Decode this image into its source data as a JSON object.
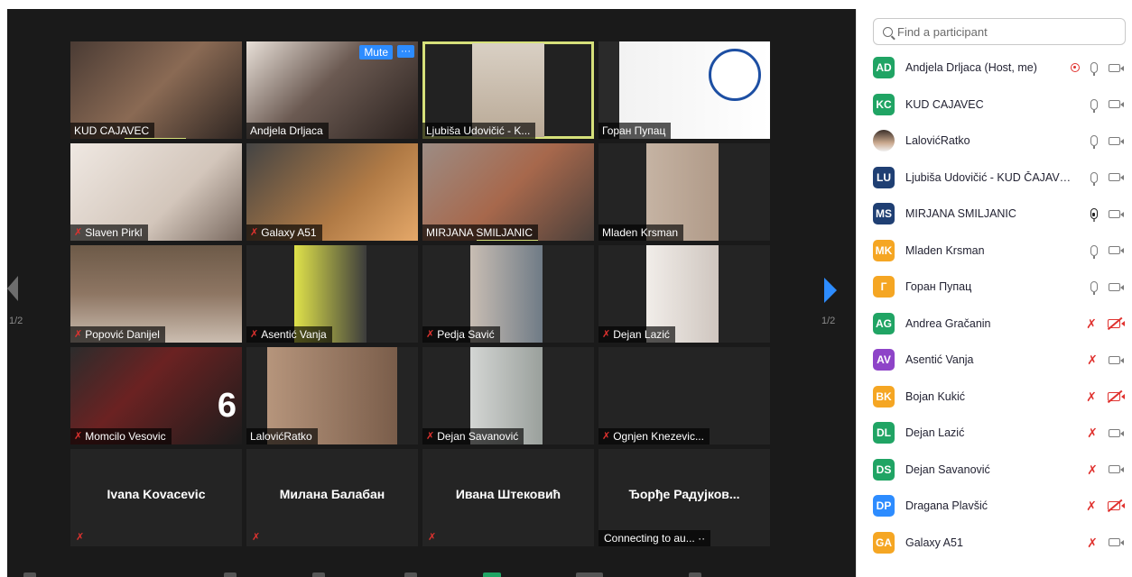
{
  "gallery": {
    "tiles": [
      {
        "name": "KUD CAJAVEC",
        "muted": false
      },
      {
        "name": "Andjela Drljaca",
        "muted": false,
        "hover_mute": "Mute",
        "hover_more": "···"
      },
      {
        "name": "Ljubiša Udovičić - K...",
        "muted": false
      },
      {
        "name": "Горан Пупац",
        "muted": false
      },
      {
        "name": "Slaven Pirkl",
        "muted": true
      },
      {
        "name": "Galaxy A51",
        "muted": true
      },
      {
        "name": "MIRJANA SMILJANIC",
        "muted": false
      },
      {
        "name": "Mladen Krsman",
        "muted": false
      },
      {
        "name": "Popović Danijel",
        "muted": true
      },
      {
        "name": "Asentić Vanja",
        "muted": true
      },
      {
        "name": "Pedja Savić",
        "muted": true
      },
      {
        "name": "Dejan Lazić",
        "muted": true
      },
      {
        "name": "Momcilo Vesovic",
        "muted": true,
        "overlay_number": "6"
      },
      {
        "name": "LalovićRatko",
        "muted": false
      },
      {
        "name": "Dejan Savanović",
        "muted": true
      },
      {
        "name": "Ognjen Knezevic...",
        "muted": true
      },
      {
        "center_name": "Ivana Kovacevic",
        "muted": true
      },
      {
        "center_name": "Милана Балабан",
        "muted": true
      },
      {
        "center_name": "Ивана Штековић",
        "muted": true
      },
      {
        "center_name": "Ђорђе Радујков...",
        "status": "Connecting to au... ··"
      }
    ],
    "page_left": "1/2",
    "page_right": "1/2",
    "accent_color": "#2d8cff",
    "speaking_color": "#d6e07a"
  },
  "participants": {
    "search_placeholder": "Find a participant",
    "list": [
      {
        "initials": "AD",
        "color": "#20a464",
        "name": "Andjela Drljaca (Host, me)",
        "recording": true,
        "mic": "on",
        "cam": "on"
      },
      {
        "initials": "KC",
        "color": "#20a464",
        "name": "KUD CAJAVEC",
        "mic": "on",
        "cam": "on"
      },
      {
        "initials": "",
        "photo": true,
        "name": "LalovićRatko",
        "mic": "on",
        "cam": "on"
      },
      {
        "initials": "LU",
        "color": "#1f3f73",
        "name": "Ljubiša Udovičić - KUD ČAJAVE...",
        "mic": "on",
        "cam": "on"
      },
      {
        "initials": "MS",
        "color": "#1f3f73",
        "name": "MIRJANA SMILJANIC",
        "mic": "active",
        "cam": "on"
      },
      {
        "initials": "MK",
        "color": "#f5a623",
        "name": "Mladen Krsman",
        "mic": "on",
        "cam": "on"
      },
      {
        "initials": "Г",
        "color": "#f5a623",
        "name": "Горан Пупац",
        "mic": "on",
        "cam": "on"
      },
      {
        "initials": "AG",
        "color": "#20a464",
        "name": "Andrea Gračanin",
        "mic": "off",
        "cam": "off"
      },
      {
        "initials": "AV",
        "color": "#8e44c8",
        "name": "Asentić Vanja",
        "mic": "off",
        "cam": "on"
      },
      {
        "initials": "BK",
        "color": "#f5a623",
        "name": "Bojan Kukić",
        "mic": "off",
        "cam": "off"
      },
      {
        "initials": "DL",
        "color": "#20a464",
        "name": "Dejan Lazić",
        "mic": "off",
        "cam": "on"
      },
      {
        "initials": "DS",
        "color": "#20a464",
        "name": "Dejan Savanović",
        "mic": "off",
        "cam": "on"
      },
      {
        "initials": "DP",
        "color": "#2d8cff",
        "name": "Dragana Plavšić",
        "mic": "off",
        "cam": "off"
      },
      {
        "initials": "GA",
        "color": "#f5a623",
        "name": "Galaxy A51",
        "mic": "off",
        "cam": "on"
      }
    ]
  }
}
